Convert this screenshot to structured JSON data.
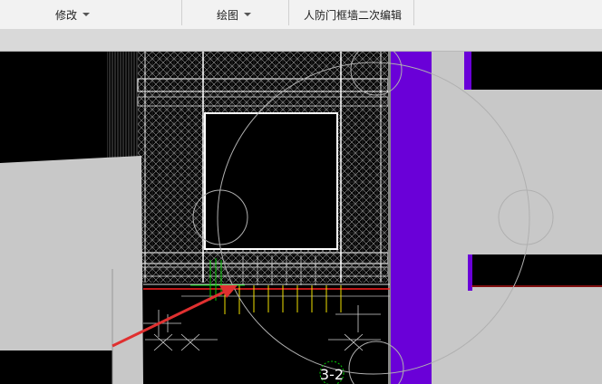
{
  "toolbar": {
    "modify_label": "修改",
    "draw_label": "绘图",
    "civil_defense_label": "人防门框墙二次编辑"
  },
  "canvas": {
    "section_label": "3-2",
    "colors": {
      "background": "#000000",
      "wall_gray": "#c8c8c8",
      "column_purple": "#6a00d8",
      "rebar_white": "#e8e8e8",
      "rebar_yellow": "#f0e000",
      "rebar_green": "#00c800",
      "baseline_red": "#ff2020",
      "arrow_red": "#e03030",
      "circle_gray": "#b0b0b0"
    }
  }
}
